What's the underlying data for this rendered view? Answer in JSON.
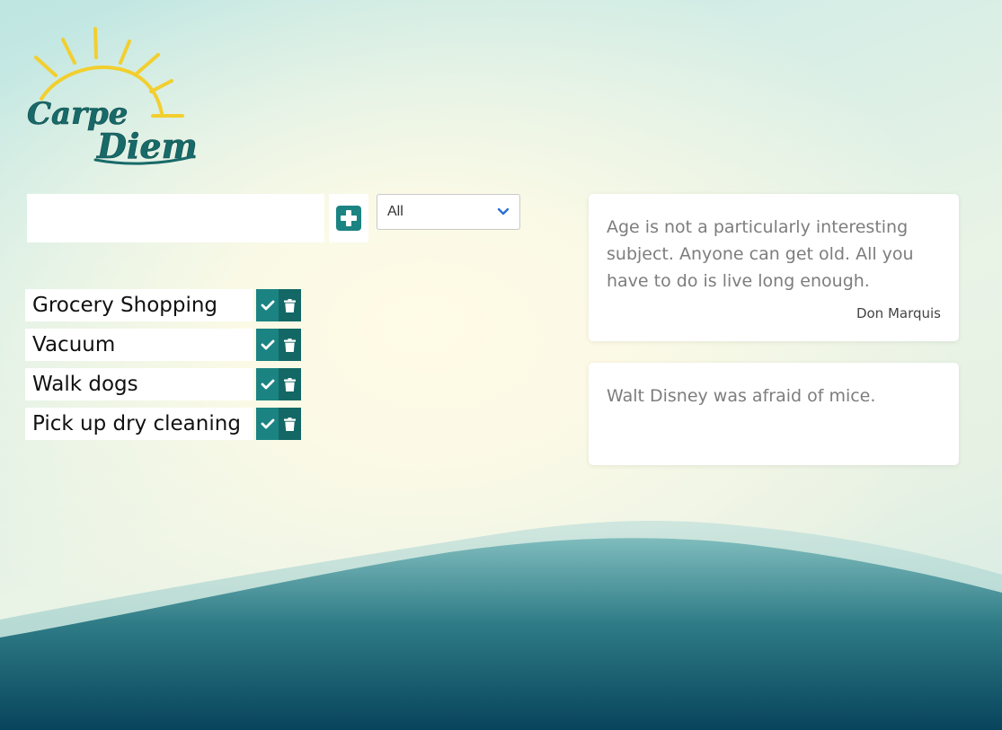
{
  "logo": {
    "line1": "Carpe",
    "line2": "Diem",
    "icon": "sun-icon"
  },
  "new_todo": {
    "value": "",
    "placeholder": "",
    "add_icon": "plus-square-icon"
  },
  "filter": {
    "selected": "All",
    "icon": "chevron-down-icon"
  },
  "todos": [
    {
      "label": "Grocery Shopping"
    },
    {
      "label": "Vacuum"
    },
    {
      "label": "Walk dogs"
    },
    {
      "label": "Pick up dry cleaning"
    }
  ],
  "todo_actions": {
    "complete_icon": "check-icon",
    "delete_icon": "trash-icon"
  },
  "quotes": [
    {
      "text": "Age is not a particularly interesting subject. Anyone can get old. All you have to do is live long enough.",
      "author": "Don Marquis"
    },
    {
      "text": "Walt Disney was afraid of mice.",
      "author": ""
    }
  ],
  "colors": {
    "teal": "#1c8383",
    "teal_dark": "#136865",
    "sun_yellow": "#f2cf2f",
    "wave_dark": "#0b4a60"
  }
}
